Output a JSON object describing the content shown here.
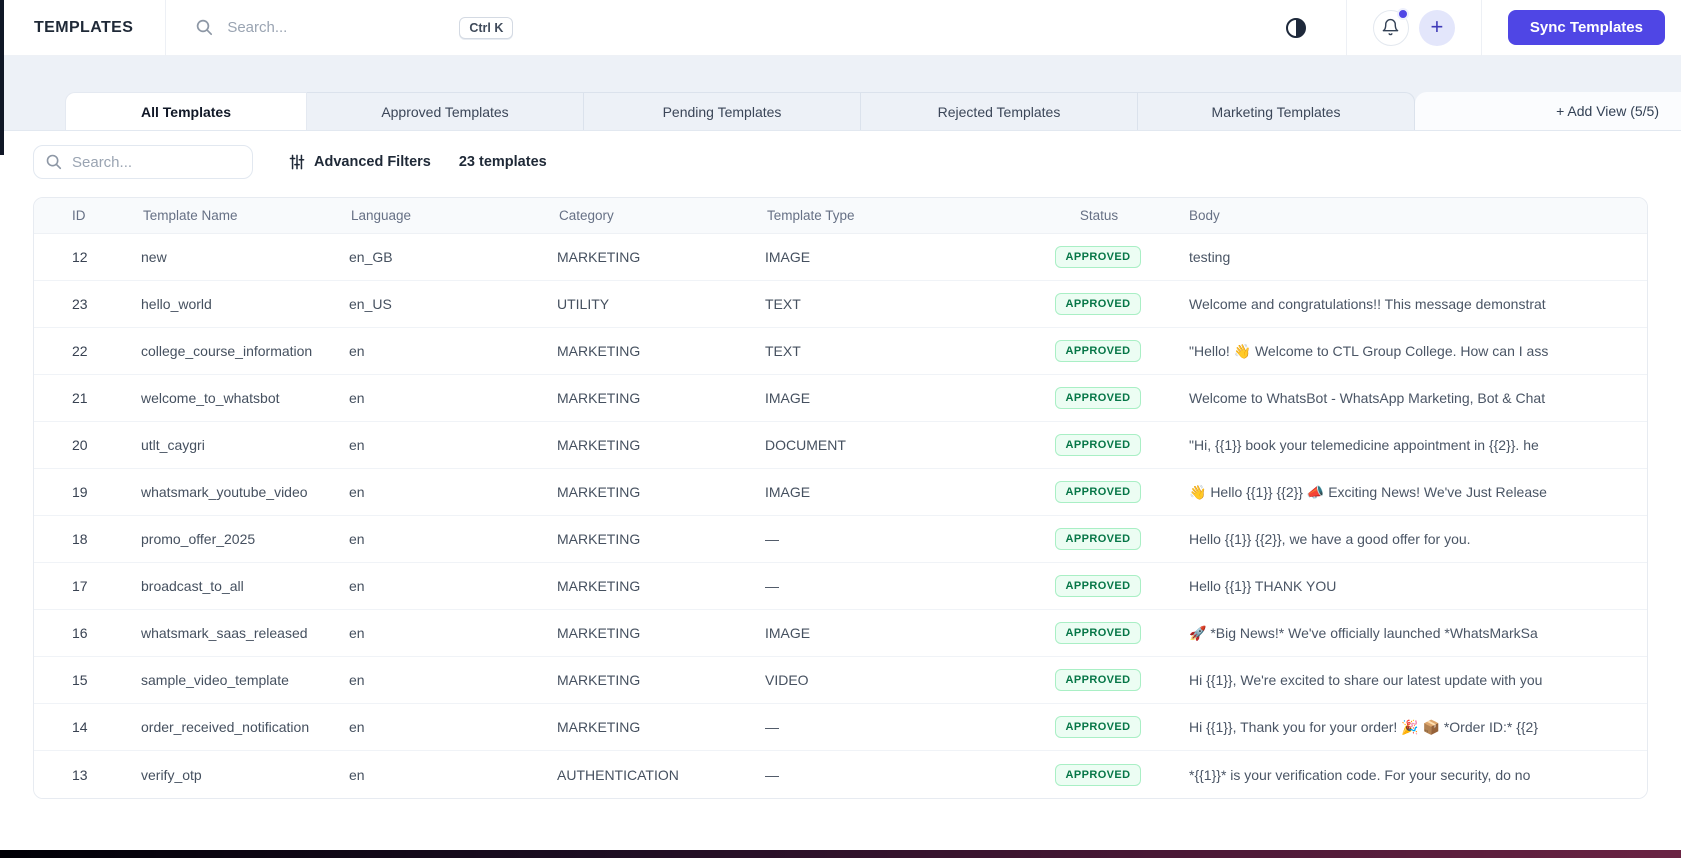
{
  "topbar": {
    "title": "TEMPLATES",
    "search_placeholder": "Search...",
    "shortcut": "Ctrl K",
    "sync_button": "Sync Templates"
  },
  "tabs": {
    "items": [
      {
        "label": "All Templates",
        "active": true
      },
      {
        "label": "Approved Templates",
        "active": false
      },
      {
        "label": "Pending Templates",
        "active": false
      },
      {
        "label": "Rejected Templates",
        "active": false
      },
      {
        "label": "Marketing Templates",
        "active": false
      }
    ],
    "add_view": "+ Add View (5/5)"
  },
  "toolbar": {
    "search_placeholder": "Search...",
    "advanced_filters": "Advanced Filters",
    "count": "23 templates"
  },
  "table": {
    "columns": [
      "ID",
      "Template Name",
      "Language",
      "Category",
      "Template Type",
      "Status",
      "Body"
    ],
    "rows": [
      {
        "id": "12",
        "name": "new",
        "language": "en_GB",
        "category": "MARKETING",
        "type": "IMAGE",
        "status": "APPROVED",
        "body": "testing"
      },
      {
        "id": "23",
        "name": "hello_world",
        "language": "en_US",
        "category": "UTILITY",
        "type": "TEXT",
        "status": "APPROVED",
        "body": "Welcome and congratulations!! This message demonstrat"
      },
      {
        "id": "22",
        "name": "college_course_information",
        "language": "en",
        "category": "MARKETING",
        "type": "TEXT",
        "status": "APPROVED",
        "body": "\"Hello! 👋 Welcome to CTL Group College. How can I ass"
      },
      {
        "id": "21",
        "name": "welcome_to_whatsbot",
        "language": "en",
        "category": "MARKETING",
        "type": "IMAGE",
        "status": "APPROVED",
        "body": "Welcome to WhatsBot - WhatsApp Marketing, Bot & Chat"
      },
      {
        "id": "20",
        "name": "utlt_caygri",
        "language": "en",
        "category": "MARKETING",
        "type": "DOCUMENT",
        "status": "APPROVED",
        "body": "\"Hi, {{1}} book your telemedicine appointment in {{2}}. he"
      },
      {
        "id": "19",
        "name": "whatsmark_youtube_video",
        "language": "en",
        "category": "MARKETING",
        "type": "IMAGE",
        "status": "APPROVED",
        "body": "👋 Hello {{1}} {{2}} 📣 Exciting News! We've Just Release"
      },
      {
        "id": "18",
        "name": "promo_offer_2025",
        "language": "en",
        "category": "MARKETING",
        "type": "—",
        "status": "APPROVED",
        "body": "Hello {{1}} {{2}}, we have a good offer for you."
      },
      {
        "id": "17",
        "name": "broadcast_to_all",
        "language": "en",
        "category": "MARKETING",
        "type": "—",
        "status": "APPROVED",
        "body": "Hello {{1}} THANK YOU"
      },
      {
        "id": "16",
        "name": "whatsmark_saas_released",
        "language": "en",
        "category": "MARKETING",
        "type": "IMAGE",
        "status": "APPROVED",
        "body": "🚀 *Big News!* We've officially launched *WhatsMarkSa"
      },
      {
        "id": "15",
        "name": "sample_video_template",
        "language": "en",
        "category": "MARKETING",
        "type": "VIDEO",
        "status": "APPROVED",
        "body": "Hi {{1}}, We're excited to share our latest update with you"
      },
      {
        "id": "14",
        "name": "order_received_notification",
        "language": "en",
        "category": "MARKETING",
        "type": "—",
        "status": "APPROVED",
        "body": "Hi {{1}}, Thank you for your order! 🎉 📦 *Order ID:* {{2}"
      },
      {
        "id": "13",
        "name": "verify_otp",
        "language": "en",
        "category": "AUTHENTICATION",
        "type": "—",
        "status": "APPROVED",
        "body": "*{{1}}* is your verification code. For your security, do no"
      }
    ]
  },
  "colors": {
    "accent": "#4f46e5",
    "badge_bg": "#ecfdf3",
    "badge_border": "#a9efc5",
    "badge_text": "#067647"
  }
}
